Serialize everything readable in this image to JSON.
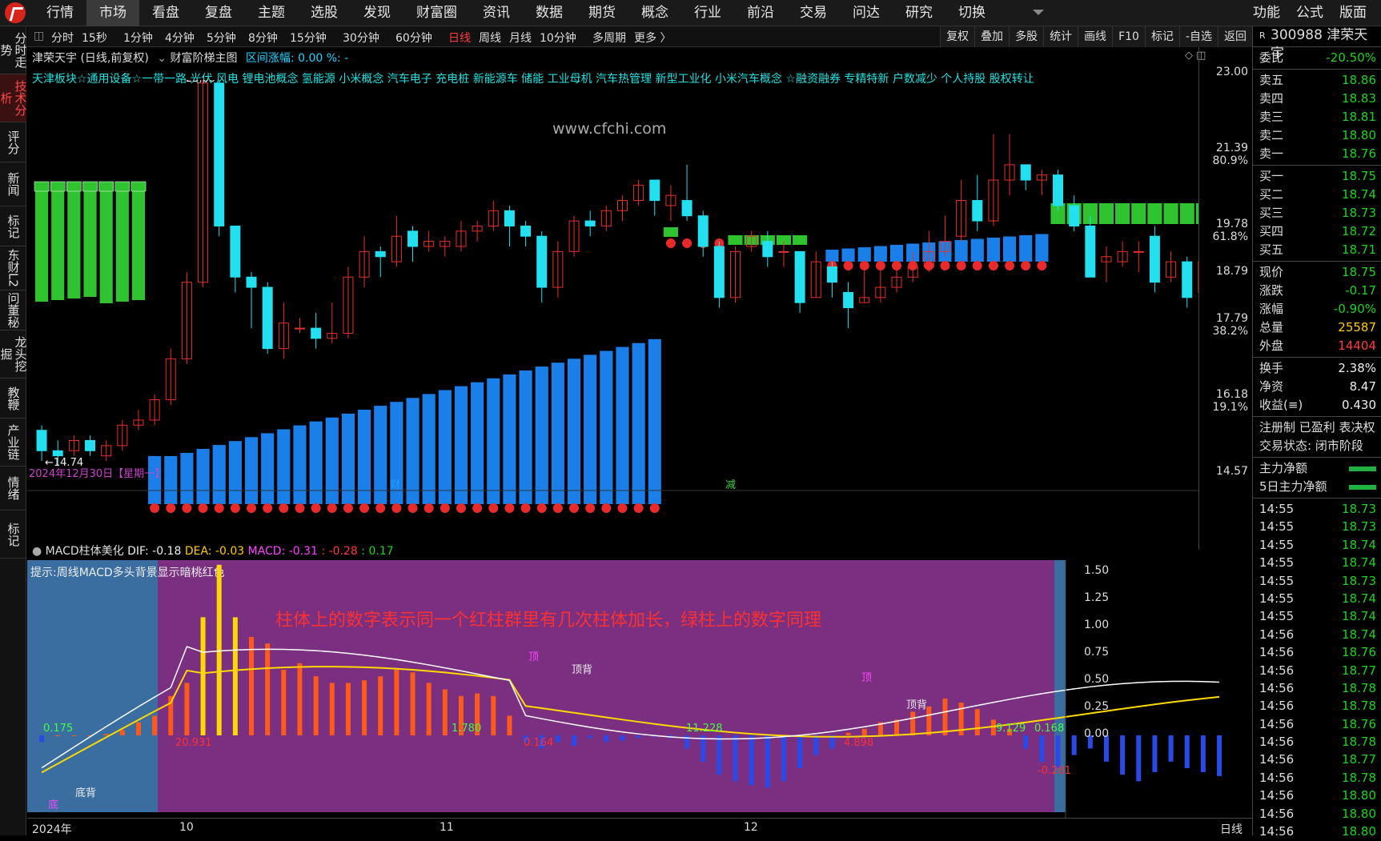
{
  "nav": {
    "items": [
      "行情",
      "市场",
      "看盘",
      "复盘",
      "主题",
      "选股",
      "发现",
      "财富圈",
      "资讯",
      "数据",
      "期货",
      "概念",
      "行业",
      "前沿",
      "交易",
      "问达",
      "研究",
      "切换"
    ],
    "active": "市场",
    "right": [
      "功能",
      "公式",
      "版面"
    ]
  },
  "leftbar": [
    "分时走势",
    "技术分析",
    "评分",
    "新闻",
    "标记",
    "东财L2",
    "问董秘",
    "龙头挖掘",
    "教鞭",
    "产业链",
    "情绪",
    "标记"
  ],
  "toolbar": {
    "periods": [
      "分时",
      "15秒",
      "1分钟",
      "4分钟",
      "5分钟",
      "8分钟",
      "15分钟",
      "30分钟",
      "60分钟",
      "日线",
      "周线",
      "月线",
      "10分钟",
      "多周期",
      "更多 〉"
    ],
    "active": "日线",
    "right": [
      "复权",
      "叠加",
      "多股",
      "统计",
      "画线",
      "F10",
      "标记",
      "-自选",
      "返回"
    ]
  },
  "chart_info": {
    "title": "津荣天宇 (日线,前复权)",
    "indicator": "财富阶梯主图",
    "range": "区间涨幅: 0.00  %: -"
  },
  "concepts": "天津板块☆通用设备☆一带一路 光伏 风电 锂电池概念 氢能源 小米概念 汽车电子 充电桩 新能源车 储能 工业母机 汽车热管理 新型工业化 小米汽车概念 ☆融资融券 专精特新 户数减少 个人持股 股权转让",
  "watermark": "www.cfchi.com",
  "price_axis": [
    "23.00",
    "21.39",
    "19.78",
    "18.79",
    "17.79",
    "16.18",
    "14.57"
  ],
  "pct_axis": [
    "80.9%",
    "61.8%",
    "38.2%",
    "19.1%"
  ],
  "annotations": {
    "high": "23.00",
    "low": "←14.74",
    "date": "2024年12月30日【星期一】",
    "cai": "财",
    "jian": "减"
  },
  "macd": {
    "header_name": "MACD柱体美化",
    "dif": "DIF: -0.18",
    "dea": "DEA: -0.03",
    "macd": "MACD: -0.31",
    "m2": ": -0.28",
    "m3": ": 0.17",
    "tip": "提示:周线MACD多头背景显示暗桃红色",
    "note": "柱体上的数字表示同一个红柱群里有几次柱体加长，绿柱上的数字同理",
    "axis": [
      "1.50",
      "1.25",
      "1.00",
      "0.75",
      "0.50",
      "0.25",
      "0.00"
    ],
    "labels": [
      "0.175",
      "20.931",
      "1.780",
      "0.164",
      "11.228",
      "4.898",
      "9.129",
      "0.168",
      "-0.281",
      "底",
      "底背",
      "顶",
      "顶背",
      "顶",
      "顶背"
    ]
  },
  "dates": [
    "2024年",
    "10",
    "11",
    "12",
    "日线"
  ],
  "side": {
    "code": "300988 津荣天宇",
    "weibi_l": "委比",
    "weibi": "-20.50%",
    "asks": [
      [
        "卖五",
        "18.86"
      ],
      [
        "卖四",
        "18.83"
      ],
      [
        "卖三",
        "18.81"
      ],
      [
        "卖二",
        "18.80"
      ],
      [
        "卖一",
        "18.76"
      ]
    ],
    "bids": [
      [
        "买一",
        "18.75"
      ],
      [
        "买二",
        "18.74"
      ],
      [
        "买三",
        "18.73"
      ],
      [
        "买四",
        "18.72"
      ],
      [
        "买五",
        "18.71"
      ]
    ],
    "stats": [
      [
        "现价",
        "18.75",
        "g"
      ],
      [
        "涨跌",
        "-0.17",
        "g"
      ],
      [
        "涨幅",
        "-0.90%",
        "g"
      ],
      [
        "总量",
        "25587",
        "y"
      ],
      [
        "外盘",
        "14404",
        "r"
      ],
      [
        "换手",
        "2.38%",
        "w"
      ],
      [
        "净资",
        "8.47",
        "w"
      ],
      [
        "收益(≡)",
        "0.430",
        "w"
      ]
    ],
    "reg": "注册制 已盈利 表决权",
    "status": "交易状态: 闭市阶段",
    "main": "主力净额",
    "main5": "5日主力净额",
    "ticks": [
      [
        "14:55",
        "18.73"
      ],
      [
        "14:55",
        "18.73"
      ],
      [
        "14:55",
        "18.74"
      ],
      [
        "14:55",
        "18.74"
      ],
      [
        "14:55",
        "18.73"
      ],
      [
        "14:55",
        "18.74"
      ],
      [
        "14:55",
        "18.74"
      ],
      [
        "14:56",
        "18.74"
      ],
      [
        "14:56",
        "18.76"
      ],
      [
        "14:56",
        "18.77"
      ],
      [
        "14:56",
        "18.78"
      ],
      [
        "14:56",
        "18.78"
      ],
      [
        "14:56",
        "18.76"
      ],
      [
        "14:56",
        "18.78"
      ],
      [
        "14:56",
        "18.77"
      ],
      [
        "14:56",
        "18.78"
      ],
      [
        "14:56",
        "18.80"
      ],
      [
        "14:56",
        "18.80"
      ],
      [
        "14:56",
        "18.80"
      ]
    ]
  },
  "candles": [
    [
      16.0,
      15.6,
      16.1,
      15.4
    ],
    [
      15.6,
      15.5,
      15.8,
      15.3
    ],
    [
      15.6,
      15.8,
      15.9,
      15.5
    ],
    [
      15.8,
      15.6,
      15.9,
      15.5
    ],
    [
      15.5,
      15.7,
      15.8,
      15.4
    ],
    [
      15.7,
      16.1,
      16.2,
      15.6
    ],
    [
      16.1,
      16.2,
      16.4,
      16.0
    ],
    [
      16.2,
      16.6,
      16.7,
      16.1
    ],
    [
      16.6,
      17.4,
      17.6,
      16.5
    ],
    [
      17.4,
      18.9,
      19.1,
      17.3
    ],
    [
      18.9,
      22.8,
      23.0,
      18.8
    ],
    [
      22.8,
      20.0,
      22.9,
      19.8
    ],
    [
      20.0,
      19.0,
      20.0,
      18.7
    ],
    [
      19.0,
      18.8,
      19.1,
      18.0
    ],
    [
      18.8,
      17.6,
      18.9,
      17.5
    ],
    [
      17.6,
      18.1,
      18.5,
      17.4
    ],
    [
      18.0,
      18.0,
      18.2,
      17.9
    ],
    [
      18.0,
      17.8,
      18.3,
      17.6
    ],
    [
      17.8,
      17.9,
      18.5,
      17.7
    ],
    [
      17.9,
      19.0,
      19.2,
      17.8
    ],
    [
      19.0,
      19.5,
      19.8,
      18.8
    ],
    [
      19.5,
      19.4,
      19.6,
      19.0
    ],
    [
      19.3,
      19.8,
      20.2,
      19.2
    ],
    [
      19.9,
      19.6,
      20.0,
      19.3
    ],
    [
      19.6,
      19.7,
      19.9,
      19.5
    ],
    [
      19.6,
      19.7,
      19.8,
      19.4
    ],
    [
      19.6,
      19.9,
      20.1,
      19.5
    ],
    [
      19.9,
      20.0,
      20.1,
      19.7
    ],
    [
      20.0,
      20.3,
      20.5,
      19.9
    ],
    [
      20.3,
      20.0,
      20.4,
      19.6
    ],
    [
      20.0,
      19.8,
      20.1,
      19.6
    ],
    [
      19.8,
      18.8,
      19.9,
      18.5
    ],
    [
      18.8,
      19.5,
      19.7,
      18.6
    ],
    [
      19.5,
      20.1,
      20.2,
      19.4
    ],
    [
      20.1,
      20.0,
      20.3,
      19.8
    ],
    [
      20.0,
      20.3,
      20.4,
      19.9
    ],
    [
      20.3,
      20.5,
      20.6,
      20.1
    ],
    [
      20.5,
      20.8,
      20.9,
      20.4
    ],
    [
      20.9,
      20.5,
      20.9,
      20.2
    ],
    [
      20.4,
      20.6,
      20.8,
      20.1
    ],
    [
      20.5,
      20.2,
      21.2,
      20.1
    ],
    [
      20.2,
      19.6,
      20.3,
      19.4
    ],
    [
      19.6,
      18.6,
      19.7,
      18.4
    ],
    [
      18.6,
      19.5,
      19.6,
      18.5
    ],
    [
      19.6,
      19.8,
      19.9,
      19.5
    ],
    [
      19.7,
      19.4,
      19.9,
      19.2
    ],
    [
      19.5,
      19.5,
      19.7,
      19.2
    ],
    [
      19.5,
      18.5,
      19.5,
      18.3
    ],
    [
      18.6,
      19.3,
      19.5,
      18.6
    ],
    [
      19.2,
      18.9,
      19.3,
      18.6
    ],
    [
      18.7,
      18.4,
      18.9,
      18.0
    ],
    [
      18.5,
      18.6,
      19.2,
      18.5
    ],
    [
      18.6,
      18.8,
      19.3,
      18.5
    ],
    [
      18.8,
      19.0,
      19.3,
      18.7
    ],
    [
      19.0,
      19.2,
      19.5,
      18.9
    ],
    [
      19.2,
      19.5,
      19.9,
      19.1
    ],
    [
      19.5,
      19.7,
      20.2,
      19.4
    ],
    [
      19.8,
      20.5,
      20.9,
      19.7
    ],
    [
      20.5,
      20.1,
      21.0,
      19.9
    ],
    [
      20.1,
      20.9,
      21.8,
      20.0
    ],
    [
      20.9,
      21.2,
      21.8,
      20.6
    ],
    [
      21.2,
      20.9,
      21.2,
      20.7
    ],
    [
      20.9,
      21.0,
      21.1,
      20.6
    ],
    [
      21.0,
      20.4,
      21.1,
      20.3
    ],
    [
      20.4,
      20.0,
      20.6,
      19.9
    ],
    [
      20.0,
      19.0,
      20.2,
      19.0
    ],
    [
      19.3,
      19.4,
      19.6,
      18.9
    ],
    [
      19.3,
      19.5,
      19.7,
      19.2
    ],
    [
      19.5,
      19.5,
      19.7,
      19.1
    ],
    [
      19.8,
      18.9,
      20.0,
      18.7
    ],
    [
      19.0,
      19.3,
      19.5,
      18.9
    ],
    [
      19.3,
      18.6,
      19.4,
      18.4
    ],
    [
      18.7,
      19.3,
      19.4,
      18.5
    ],
    [
      19.3,
      19.0,
      19.3,
      18.9
    ],
    [
      18.9,
      18.8,
      19.0,
      18.7
    ]
  ],
  "ladder_up": [
    [
      9,
      40,
      [
        16.2,
        16.9
      ]
    ],
    [
      41,
      60,
      [
        17.9,
        18.3
      ]
    ],
    [
      61,
      72,
      [
        17.0,
        18.6
      ]
    ]
  ],
  "macd_bars": [
    -0.05,
    0,
    0,
    0,
    0.01,
    0.04,
    0.1,
    0.15,
    0.3,
    0.4,
    0.9,
    1.3,
    0.9,
    0.75,
    0.7,
    0.5,
    0.55,
    0.45,
    0.4,
    0.4,
    0.42,
    0.45,
    0.5,
    0.48,
    0.4,
    0.35,
    0.3,
    0.32,
    0.3,
    0.15,
    -0.05,
    -0.1,
    -0.05,
    -0.08,
    -0.02,
    -0.05,
    -0.04,
    -0.02,
    -0.01,
    -0.02,
    -0.1,
    -0.2,
    -0.3,
    -0.35,
    -0.38,
    -0.4,
    -0.35,
    -0.25,
    -0.15,
    -0.1,
    0.02,
    0.05,
    0.1,
    0.12,
    0.18,
    0.22,
    0.28,
    0.25,
    0.2,
    0.12,
    0.05,
    -0.1,
    -0.2,
    -0.25,
    -0.15,
    -0.1,
    -0.2,
    -0.3,
    -0.35,
    -0.28,
    -0.2,
    -0.25,
    -0.28,
    -0.31
  ]
}
